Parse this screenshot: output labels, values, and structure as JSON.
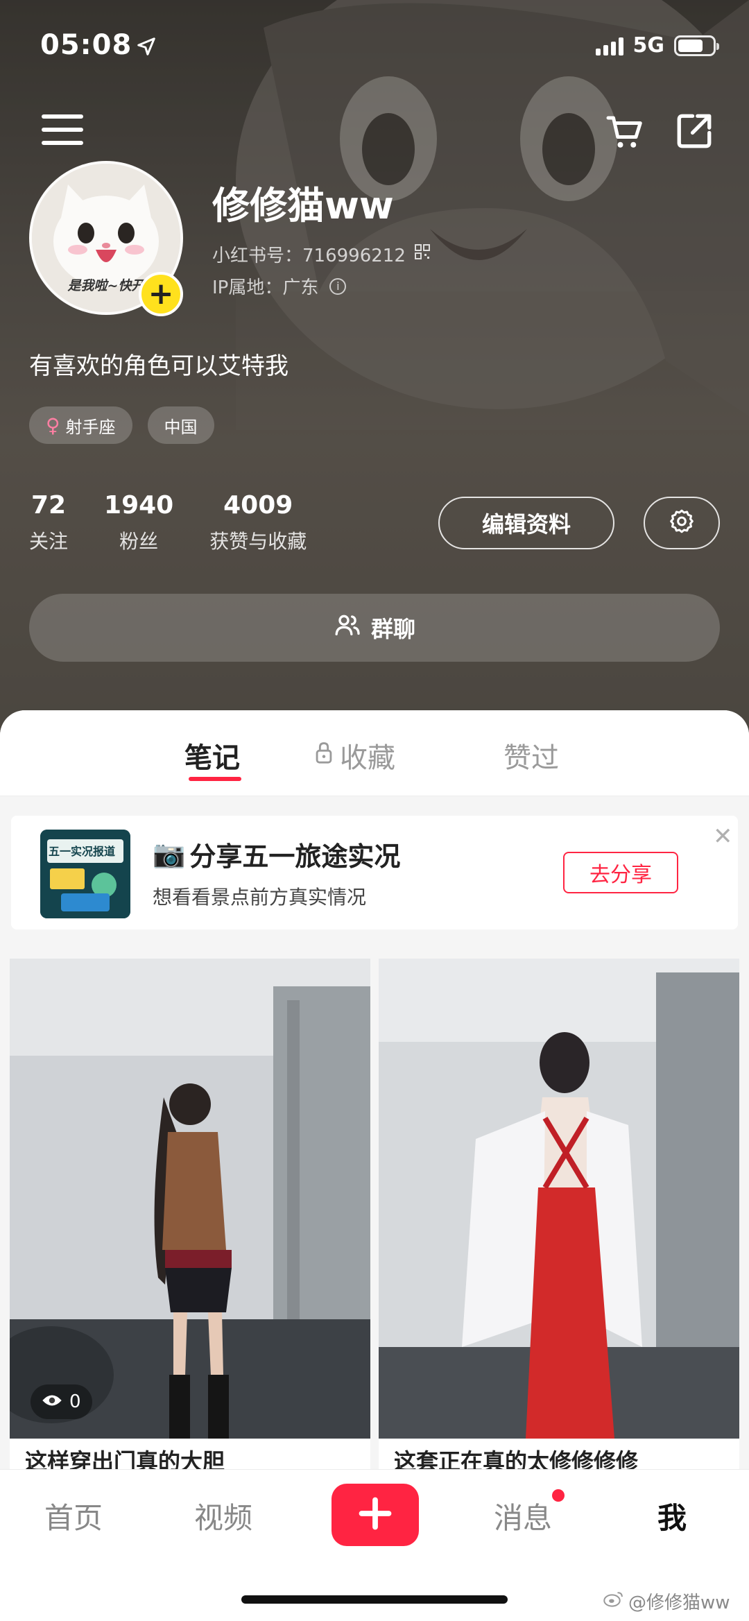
{
  "status_bar": {
    "time": "05:08",
    "network": "5G",
    "battery_level": 0.72
  },
  "profile": {
    "nickname": "修修猫ww",
    "red_id": "小红书号：716996212",
    "ip_location": "IP属地：广东",
    "avatar_caption": "是我啦~快开",
    "bio": "有喜欢的角色可以艾特我",
    "tags": [
      "射手座",
      "中国"
    ]
  },
  "stats": [
    {
      "value": "72",
      "label": "关注"
    },
    {
      "value": "1940",
      "label": "粉丝"
    },
    {
      "value": "4009",
      "label": "获赞与收藏"
    }
  ],
  "buttons": {
    "edit_profile": "编辑资料",
    "group_chat": "群聊"
  },
  "tabs": [
    "笔记",
    "收藏",
    "赞过"
  ],
  "banner": {
    "emoji": "📷",
    "title": "分享五一旅途实况",
    "subtitle": "想看看景点前方真实情况",
    "cta": "去分享",
    "thumb_text": "五一实况报道"
  },
  "notes": [
    {
      "views": "0",
      "title": "这样穿出门真的大胆"
    },
    {
      "title": "这套正在真的太修修修修"
    }
  ],
  "bottom_nav": [
    "首页",
    "视频",
    "消息",
    "我"
  ],
  "watermark": "@修修猫ww",
  "colors": {
    "accent": "#ff2442",
    "avatar_badge": "#ffe11d"
  }
}
